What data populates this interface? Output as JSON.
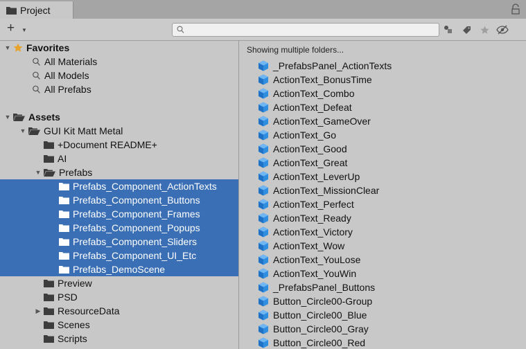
{
  "tab": {
    "label": "Project"
  },
  "toolbar": {
    "add_label": "+",
    "search_placeholder": "",
    "search_value": ""
  },
  "favorites": {
    "label": "Favorites",
    "items": [
      "All Materials",
      "All Models",
      "All Prefabs"
    ]
  },
  "assets": {
    "label": "Assets",
    "tree": [
      {
        "label": "GUI Kit Matt Metal",
        "depth": 1,
        "expanded": true
      },
      {
        "label": "+Document README+",
        "depth": 2
      },
      {
        "label": "AI",
        "depth": 2
      },
      {
        "label": "Prefabs",
        "depth": 2,
        "expanded": true
      },
      {
        "label": "Prefabs_Component_ActionTexts",
        "depth": 3,
        "selected": true
      },
      {
        "label": "Prefabs_Component_Buttons",
        "depth": 3,
        "selected": true
      },
      {
        "label": "Prefabs_Component_Frames",
        "depth": 3,
        "selected": true
      },
      {
        "label": "Prefabs_Component_Popups",
        "depth": 3,
        "selected": true
      },
      {
        "label": "Prefabs_Component_Sliders",
        "depth": 3,
        "selected": true
      },
      {
        "label": "Prefabs_Component_UI_Etc",
        "depth": 3,
        "selected": true
      },
      {
        "label": "Prefabs_DemoScene",
        "depth": 3,
        "selected": true
      },
      {
        "label": "Preview",
        "depth": 2
      },
      {
        "label": "PSD",
        "depth": 2
      },
      {
        "label": "ResourceData",
        "depth": 2,
        "collapsed": true
      },
      {
        "label": "Scenes",
        "depth": 2
      },
      {
        "label": "Scripts",
        "depth": 2
      }
    ]
  },
  "content": {
    "header": "Showing multiple folders...",
    "items": [
      "_PrefabsPanel_ActionTexts",
      "ActionText_BonusTime",
      "ActionText_Combo",
      "ActionText_Defeat",
      "ActionText_GameOver",
      "ActionText_Go",
      "ActionText_Good",
      "ActionText_Great",
      "ActionText_LeverUp",
      "ActionText_MissionClear",
      "ActionText_Perfect",
      "ActionText_Ready",
      "ActionText_Victory",
      "ActionText_Wow",
      "ActionText_YouLose",
      "ActionText_YouWin",
      "_PrefabsPanel_Buttons",
      "Button_Circle00-Group",
      "Button_Circle00_Blue",
      "Button_Circle00_Gray",
      "Button_Circle00_Red"
    ]
  },
  "colors": {
    "selection": "#3a6fb5",
    "panel": "#c8c8c8",
    "folder": "#3d3d3d",
    "prefab": "#2f8ee0"
  }
}
